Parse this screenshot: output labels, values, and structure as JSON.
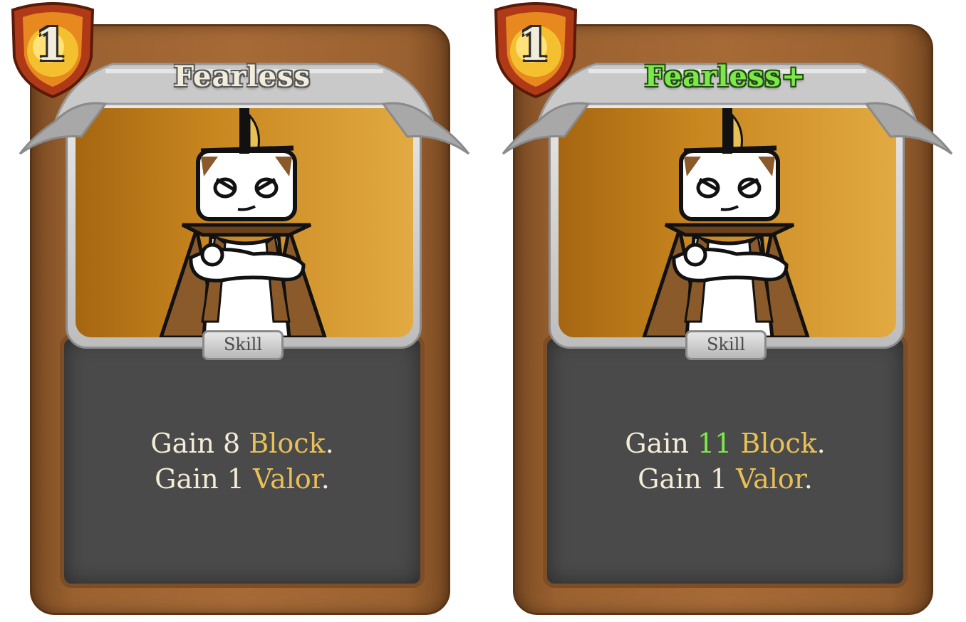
{
  "cards": [
    {
      "cost": "1",
      "title": "Fearless",
      "type": "Skill",
      "desc": {
        "line1": {
          "prefix": "Gain ",
          "value": "8",
          "space": " ",
          "keyword": "Block",
          "suffix": "."
        },
        "line2": {
          "prefix": "Gain 1 ",
          "keyword": "Valor",
          "suffix": "."
        }
      }
    },
    {
      "cost": "1",
      "title": "Fearless+",
      "type": "Skill",
      "desc": {
        "line1": {
          "prefix": "Gain ",
          "value": "11",
          "space": " ",
          "keyword": "Block",
          "suffix": "."
        },
        "line2": {
          "prefix": "Gain 1 ",
          "keyword": "Valor",
          "suffix": "."
        }
      }
    }
  ],
  "colors": {
    "keyword": "#e8c056",
    "upgrade": "#7ce84a",
    "frame": "#a66a36",
    "panel": "#4a4a4a"
  }
}
